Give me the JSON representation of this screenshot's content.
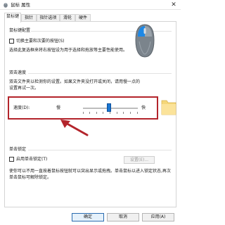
{
  "window": {
    "title": "鼠标 属性",
    "close_glyph": "✕"
  },
  "tabs": [
    {
      "label": "鼠标键",
      "active": true
    },
    {
      "label": "指针"
    },
    {
      "label": "指针选项"
    },
    {
      "label": "滑轮"
    },
    {
      "label": "硬件"
    }
  ],
  "button_config": {
    "title": "鼠标键配置",
    "checkbox_label": "切换主要和次要的按钮(S)",
    "description": "选择此复选框来将右按钮设为用于选择和拖放等主要性能使用。"
  },
  "double_click": {
    "title": "双击速度",
    "description": "双击文件夹以检测你的设置。如果文件夹没打开或关闭，请用慢一点的设置再试一次。",
    "speed_label": "速度(D):",
    "slow_label": "慢",
    "fast_label": "快",
    "speed_value": 0.48
  },
  "click_lock": {
    "title": "单击锁定",
    "checkbox_label": "启用单击锁定(T)",
    "settings_button": "设置(E)...",
    "description": "使你可以不用一直按着鼠标按钮就可以突出显示或拖拽。单击鼠标以进入锁定状态,再次单击鼠标可解除锁定。"
  },
  "footer": {
    "ok": "确定",
    "cancel": "取消",
    "apply": "应用(A)"
  },
  "colors": {
    "accent": "#1976d2",
    "highlight": "#b3242b"
  }
}
